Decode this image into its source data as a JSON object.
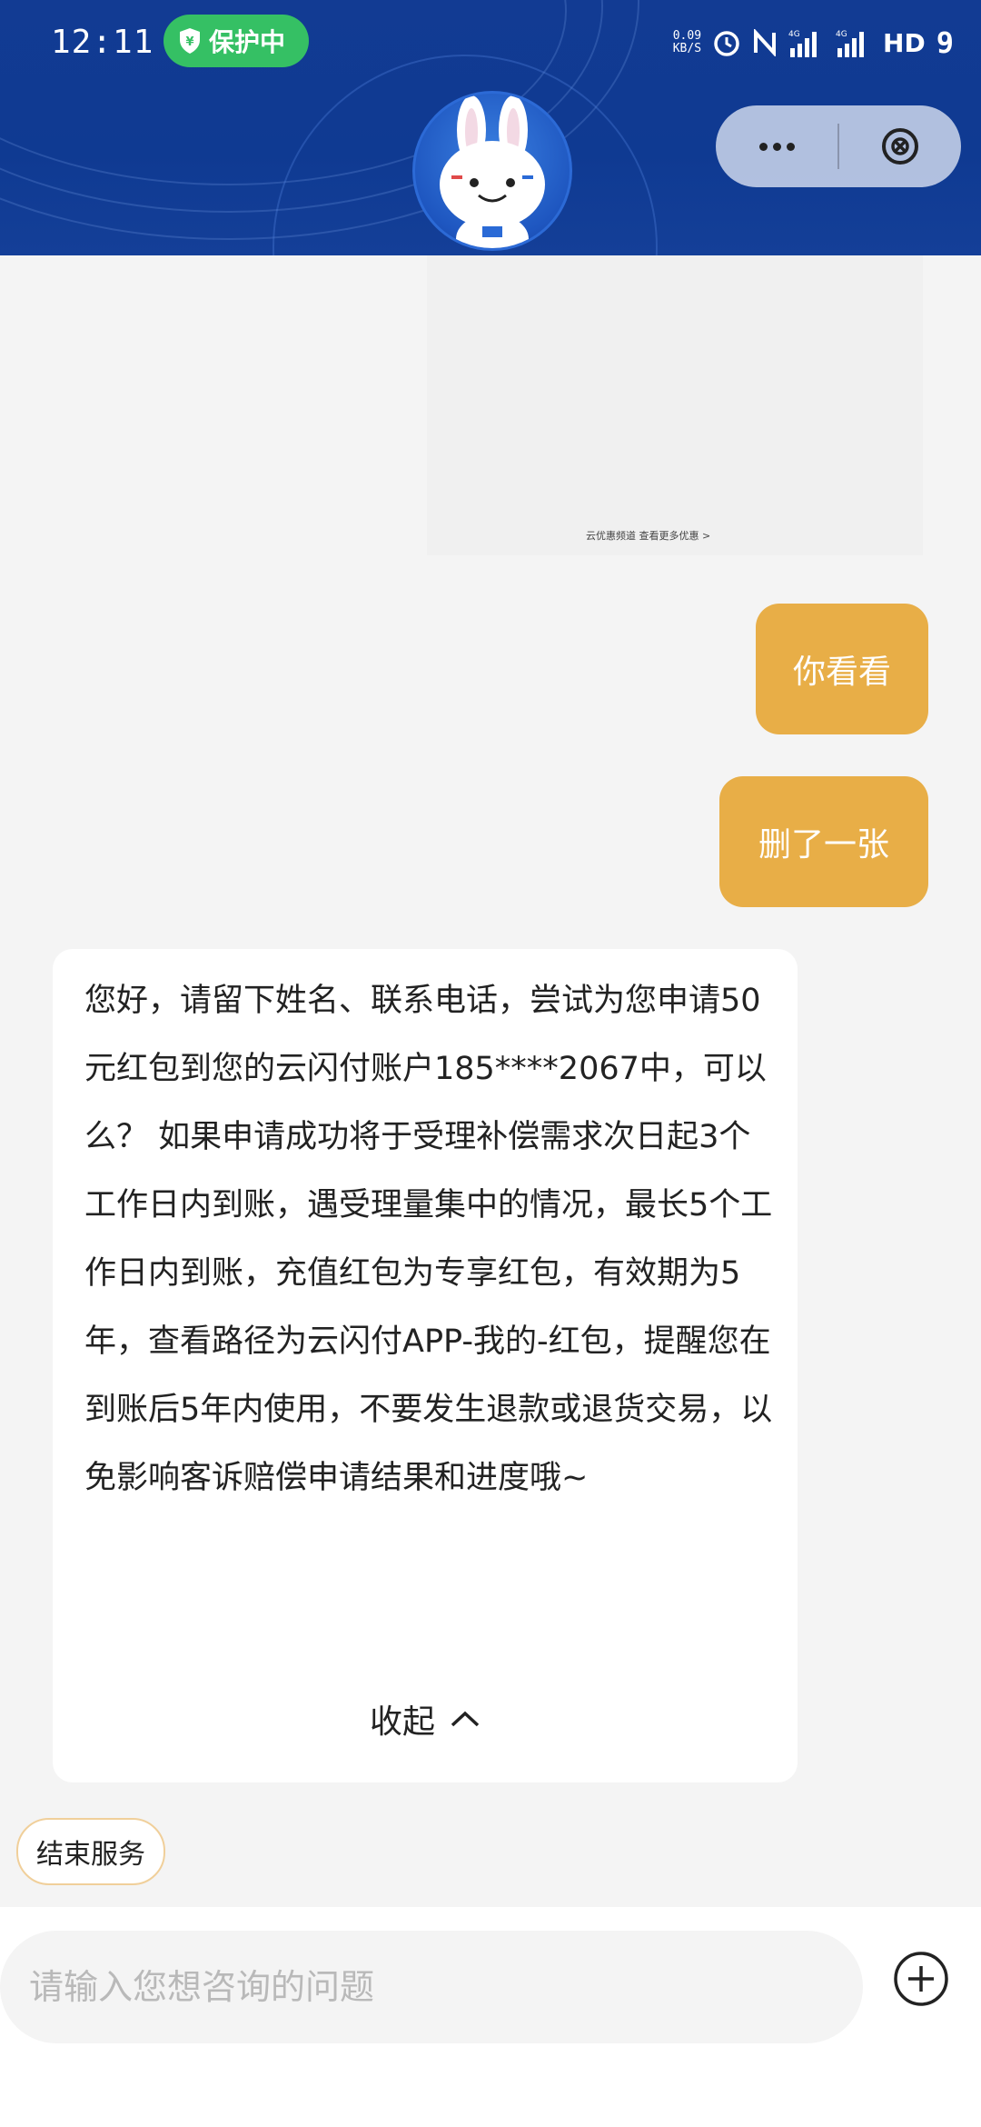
{
  "status_bar": {
    "time": "12:11",
    "protect_label": "保护中",
    "net_speed_value": "0.09",
    "net_speed_unit": "KB/S",
    "hd_label": "HD",
    "battery": "9"
  },
  "capsule": {
    "more_icon": "more-dots-icon",
    "close_icon": "close-circle-icon"
  },
  "card_image": {
    "caption": "云优惠频道 查看更多优惠 >"
  },
  "messages": {
    "user_1": "你看看",
    "user_2": "删了一张",
    "bot_reply": "您好，请留下姓名、联系电话，尝试为您申请50元红包到您的云闪付账户185****2067中，可以么？ 如果申请成功将于受理补偿需求次日起3个工作日内到账，遇受理量集中的情况，最长5个工作日内到账，充值红包为专享红包，有效期为5年，查看路径为云闪付APP-我的-红包，提醒您在到账后5年内使用，不要发生退款或退货交易，以免影响客诉赔偿申请结果和进度哦~",
    "collapse_label": "收起"
  },
  "quick_action": {
    "end_service": "结束服务"
  },
  "input": {
    "placeholder": "请输入您想咨询的问题",
    "value": ""
  },
  "colors": {
    "header_blue": "#123b93",
    "user_bubble": "#e8ae47",
    "protect_green": "#35c064"
  }
}
